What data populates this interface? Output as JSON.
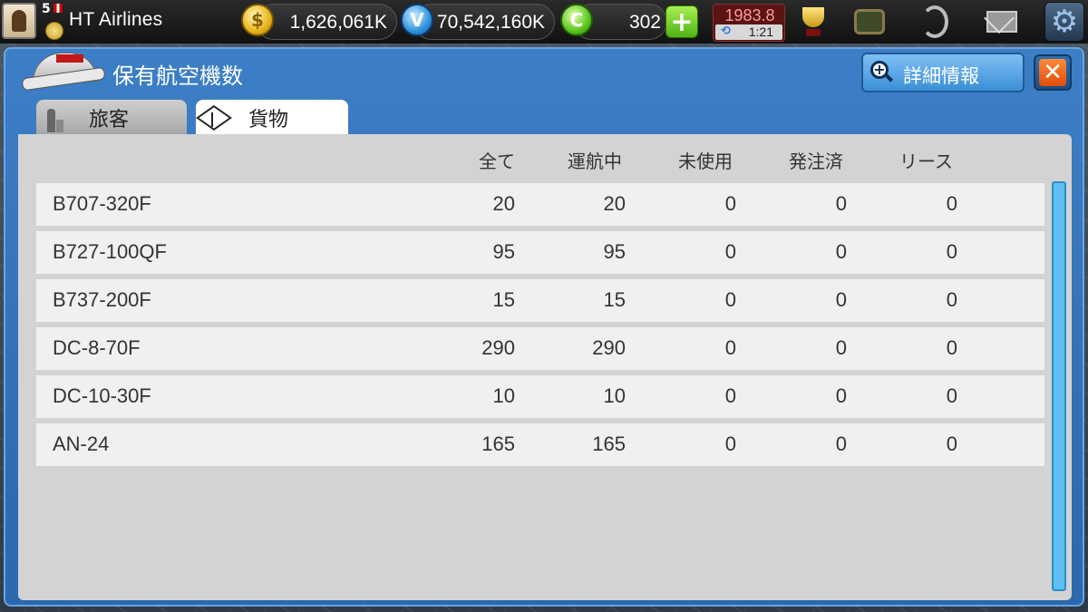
{
  "topbar": {
    "level": "5",
    "company": "HT Airlines",
    "money": "1,626,061K",
    "vp": "70,542,160K",
    "coins": "302",
    "plus_symbol": "+",
    "year": "1983.8",
    "time": "1:21",
    "icons": [
      "avatar",
      "level-medal-icon",
      "gold-coin-icon",
      "v-coin-icon",
      "green-coin-icon",
      "trophy-icon",
      "tv-icon",
      "satellite-icon",
      "mail-icon",
      "gear-icon"
    ]
  },
  "panel": {
    "title": "保有航空機数",
    "details_label": "詳細情報",
    "close_symbol": "✕",
    "tabs": [
      {
        "label": "旅客",
        "active": false
      },
      {
        "label": "貨物",
        "active": true
      }
    ]
  },
  "table": {
    "columns": [
      "全て",
      "運航中",
      "未使用",
      "発注済",
      "リース"
    ],
    "rows": [
      {
        "name": "B707-320F",
        "values": [
          "20",
          "20",
          "0",
          "0",
          "0"
        ]
      },
      {
        "name": "B727-100QF",
        "values": [
          "95",
          "95",
          "0",
          "0",
          "0"
        ]
      },
      {
        "name": "B737-200F",
        "values": [
          "15",
          "15",
          "0",
          "0",
          "0"
        ]
      },
      {
        "name": "DC-8-70F",
        "values": [
          "290",
          "290",
          "0",
          "0",
          "0"
        ]
      },
      {
        "name": "DC-10-30F",
        "values": [
          "10",
          "10",
          "0",
          "0",
          "0"
        ]
      },
      {
        "name": "AN-24",
        "values": [
          "165",
          "165",
          "0",
          "0",
          "0"
        ]
      }
    ]
  },
  "colors": {
    "panel_blue": "#3d7fc7",
    "close_orange": "#e24c0b",
    "plus_green": "#4fb315",
    "scrollbar": "#5ec0f2"
  }
}
